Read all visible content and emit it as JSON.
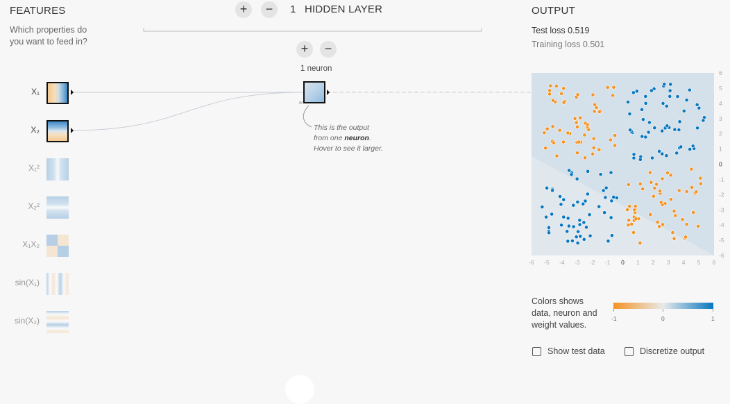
{
  "features": {
    "title": "FEATURES",
    "subtitle_line1": "Which properties do",
    "subtitle_line2": "you want to feed in?",
    "items": [
      {
        "label": "X₁",
        "active": true
      },
      {
        "label": "X₂",
        "active": true
      },
      {
        "label": "X₁²",
        "active": false
      },
      {
        "label": "X₂²",
        "active": false
      },
      {
        "label": "X₁X₂",
        "active": false
      },
      {
        "label": "sin(X₁)",
        "active": false
      },
      {
        "label": "sin(X₂)",
        "active": false
      }
    ]
  },
  "hidden": {
    "plus_label": "+",
    "minus_label": "−",
    "layer_count": "1",
    "layer_label": "HIDDEN LAYER",
    "neuron_label": "1 neuron",
    "note_part1": "This is the output from one ",
    "note_bold": "neuron",
    "note_part2": ". Hover to see it larger."
  },
  "output": {
    "title": "OUTPUT",
    "test_loss_label": "Test loss",
    "test_loss_value": "0.519",
    "training_loss_label": "Training loss",
    "training_loss_value": "0.501",
    "x_ticks": [
      "-6",
      "-5",
      "-4",
      "-3",
      "-2",
      "-1",
      "0",
      "1",
      "2",
      "3",
      "4",
      "5",
      "6"
    ],
    "y_ticks": [
      "6",
      "5",
      "4",
      "3",
      "2",
      "1",
      "0",
      "-1",
      "-2",
      "-3",
      "-4",
      "-5",
      "-6"
    ]
  },
  "legend": {
    "text_line1": "Colors shows",
    "text_line2": "data, neuron and",
    "text_line3": "weight values.",
    "min_label": "-1",
    "mid_label": "0",
    "max_label": "1"
  },
  "options": {
    "show_test_label": "Show test data",
    "discretize_label": "Discretize output",
    "show_test_checked": false,
    "discretize_checked": false
  },
  "colors": {
    "orange": "#f59322",
    "blue": "#0877bd",
    "bg_light_blue": "#d4e0ea",
    "bg_lighter": "#dfe6ec"
  }
}
